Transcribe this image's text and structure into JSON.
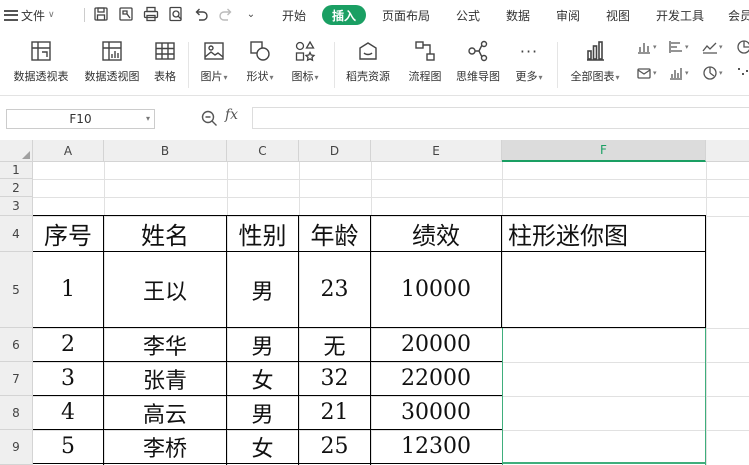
{
  "menubar": {
    "file_label": "文件",
    "tabs": [
      "开始",
      "插入",
      "页面布局",
      "公式",
      "数据",
      "审阅",
      "视图",
      "开发工具",
      "会员"
    ],
    "active_tab": "插入"
  },
  "ribbon": {
    "buttons": [
      {
        "label": "数据透视表",
        "icon": "pivot-table-icon"
      },
      {
        "label": "数据透视图",
        "icon": "pivot-chart-icon"
      },
      {
        "label": "表格",
        "icon": "table-icon"
      },
      {
        "label": "图片",
        "icon": "picture-icon"
      },
      {
        "label": "形状",
        "icon": "shape-icon"
      },
      {
        "label": "图标",
        "icon": "icon-library-icon"
      },
      {
        "label": "稻壳资源",
        "icon": "docer-resource-icon"
      },
      {
        "label": "流程图",
        "icon": "flowchart-icon"
      },
      {
        "label": "思维导图",
        "icon": "mindmap-icon"
      },
      {
        "label": "更多",
        "icon": "more-dots-icon"
      },
      {
        "label": "全部图表",
        "icon": "all-charts-icon"
      }
    ]
  },
  "formula_bar": {
    "cell_ref": "F10",
    "fx_label": "fx",
    "formula": ""
  },
  "sheet": {
    "columns": [
      "A",
      "B",
      "C",
      "D",
      "E",
      "F"
    ],
    "selected_column": "F",
    "rows": [
      "1",
      "2",
      "3",
      "4",
      "5",
      "6",
      "7",
      "8",
      "9"
    ],
    "table_header": [
      "序号",
      "姓名",
      "性别",
      "年龄",
      "绩效",
      "柱形迷你图"
    ],
    "table_rows": [
      [
        "1",
        "王以",
        "男",
        "23",
        "10000"
      ],
      [
        "2",
        "李华",
        "男",
        "无",
        "20000"
      ],
      [
        "3",
        "张青",
        "女",
        "32",
        "22000"
      ],
      [
        "4",
        "高云",
        "男",
        "21",
        "30000"
      ],
      [
        "5",
        "李桥",
        "女",
        "25",
        "12300"
      ]
    ]
  },
  "colors": {
    "accent": "#1a9f63",
    "header_bg": "#efefef",
    "gridline": "#e1e1e1"
  }
}
